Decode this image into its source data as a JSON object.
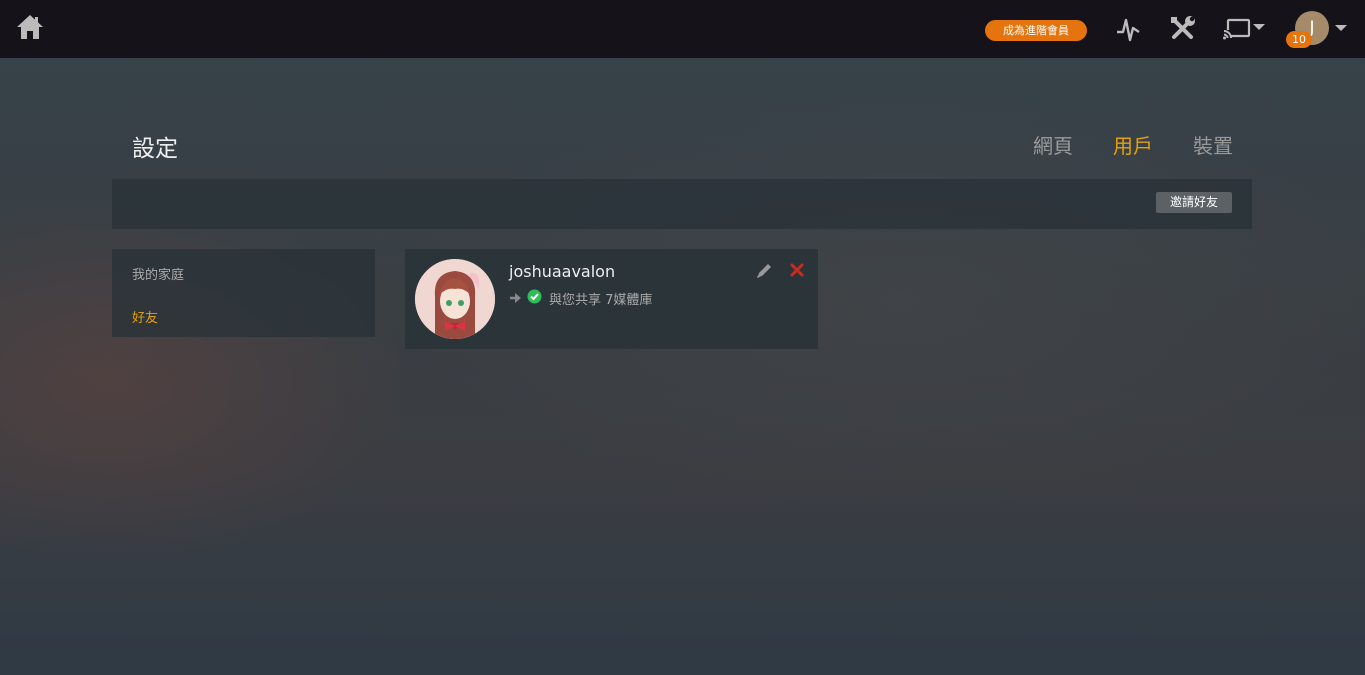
{
  "topbar": {
    "home_icon": "home-icon",
    "premium_label": "成為進階會員",
    "activity_icon": "activity-icon",
    "tools_icon": "tools-icon",
    "cast_icon": "cast-icon",
    "user_initial": "J",
    "notification_count": "10",
    "accent_color": "#e5740f"
  },
  "header": {
    "title": "設定",
    "tabs": [
      {
        "label": "網頁",
        "active": false
      },
      {
        "label": "用戶",
        "active": true
      },
      {
        "label": "裝置",
        "active": false
      }
    ],
    "active_color": "#e5a00d"
  },
  "toolbar": {
    "invite_label": "邀請好友"
  },
  "sidebar": {
    "items": [
      {
        "label": "我的家庭",
        "active": false
      },
      {
        "label": "好友",
        "active": true
      }
    ]
  },
  "friends": [
    {
      "username": "joshuaavalon",
      "share_text": "與您共享 7媒體庫",
      "status_color": "#2ebd59",
      "remove_color": "#cc2a1e"
    }
  ]
}
